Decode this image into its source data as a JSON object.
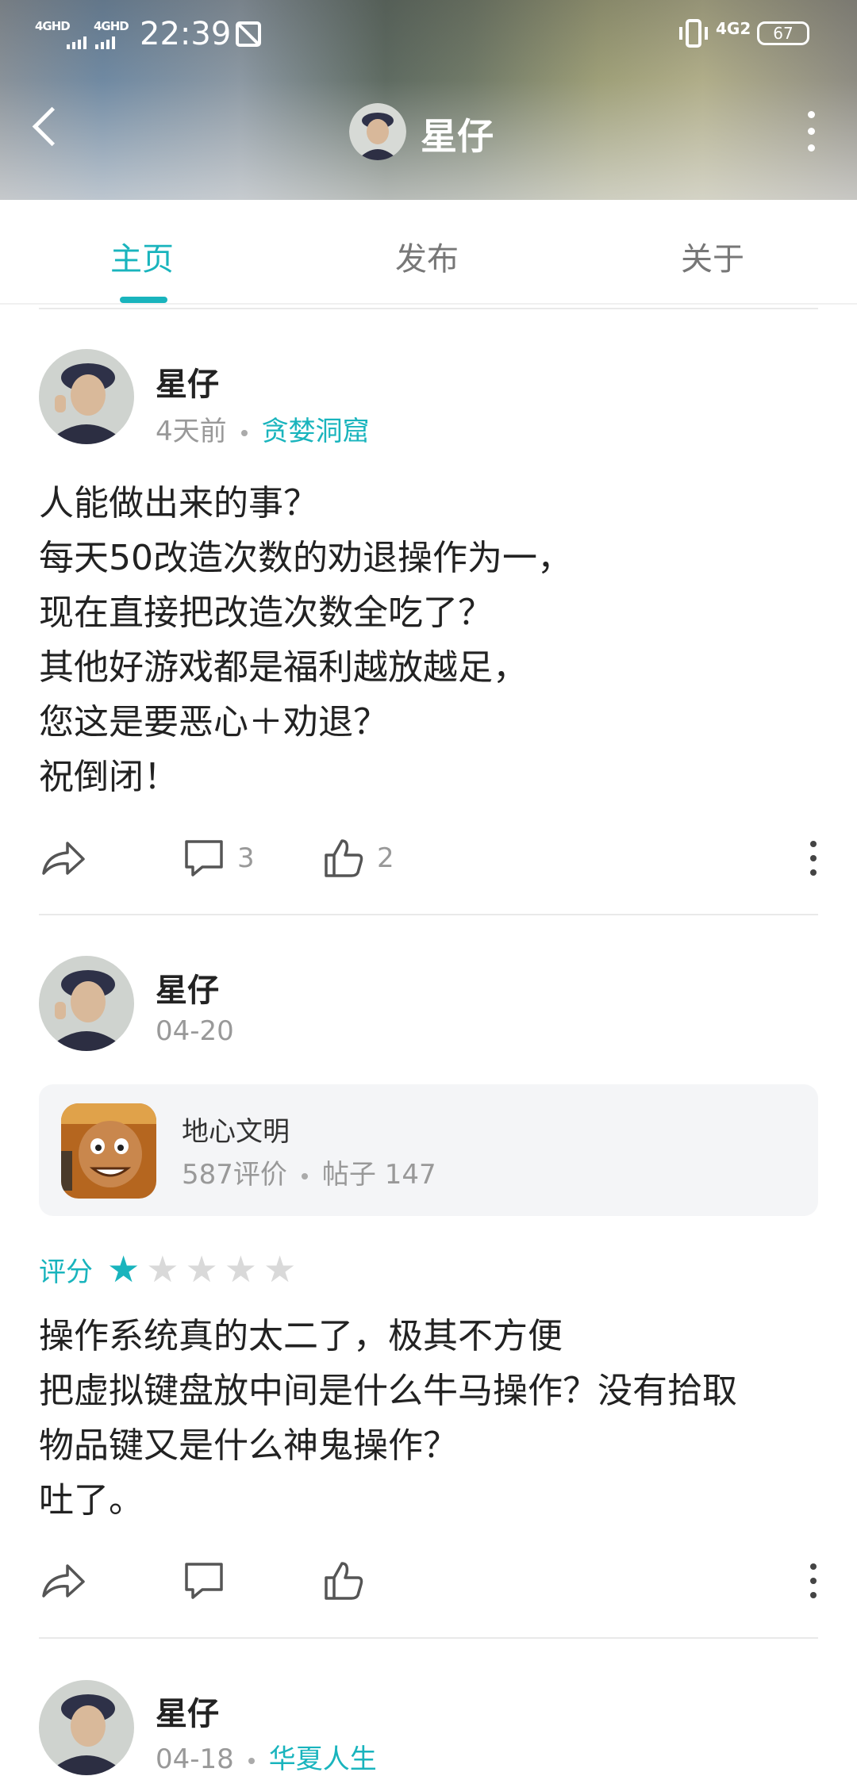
{
  "status_bar": {
    "signal1": "4GHD",
    "signal2": "4GHD",
    "time": "22:39",
    "network": "4G2",
    "battery": "67"
  },
  "nav": {
    "title": "星仔"
  },
  "tabs": [
    {
      "label": "主页",
      "active": true
    },
    {
      "label": "发布",
      "active": false
    },
    {
      "label": "关于",
      "active": false
    }
  ],
  "posts": [
    {
      "author": "星仔",
      "time": "4天前",
      "tag": "贪婪洞窟",
      "lines": [
        "人能做出来的事？",
        "每天50改造次数的劝退操作为一，",
        "现在直接把改造次数全吃了？",
        "其他好游戏都是福利越放越足，",
        "您这是要恶心＋劝退？",
        "祝倒闭！"
      ],
      "comments": "3",
      "likes": "2"
    },
    {
      "author": "星仔",
      "time": "04-20",
      "game": {
        "name": "地心文明",
        "reviews": "587评价",
        "posts": "帖子 147"
      },
      "rating_label": "评分",
      "rating": 1,
      "rating_max": 5,
      "lines": [
        "操作系统真的太二了，极其不方便",
        "把虚拟键盘放中间是什么牛马操作？没有拾取",
        "物品键又是什么神鬼操作？",
        "吐了。"
      ]
    },
    {
      "author": "星仔",
      "time": "04-18",
      "tag": "华夏人生"
    }
  ],
  "colors": {
    "accent": "#19b4bd",
    "star_off": "#d9d9d9"
  }
}
